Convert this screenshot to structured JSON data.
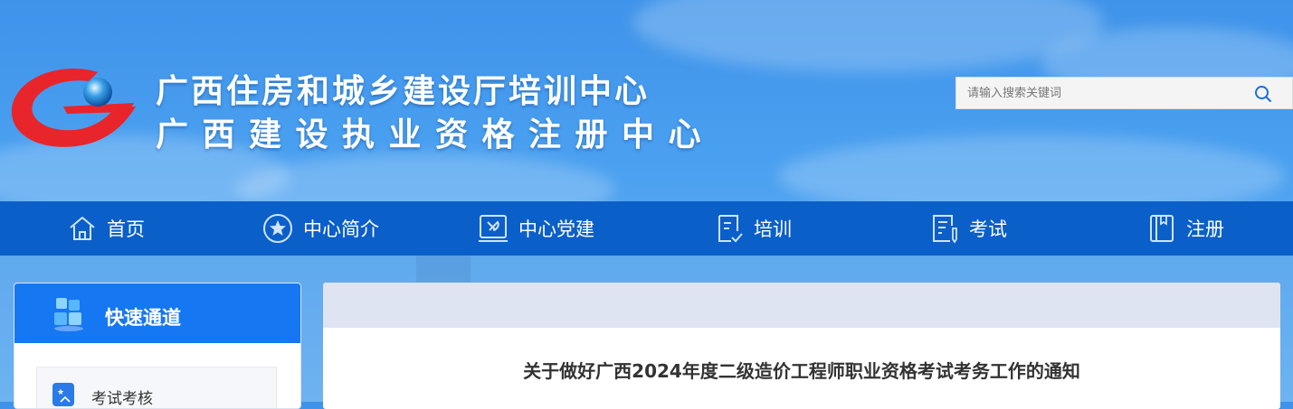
{
  "header": {
    "title_line1": "广西住房和城乡建设厅培训中心",
    "title_line2": "广西建设执业资格注册中心",
    "logo_icon": "org-logo",
    "search": {
      "placeholder": "请输入搜索关键词",
      "value": "",
      "icon": "search-icon"
    }
  },
  "nav": {
    "items": [
      {
        "label": "首页",
        "icon": "home-icon"
      },
      {
        "label": "中心简介",
        "icon": "star-circle-icon"
      },
      {
        "label": "中心党建",
        "icon": "party-emblem-icon"
      },
      {
        "label": "培训",
        "icon": "document-check-icon"
      },
      {
        "label": "考试",
        "icon": "exam-paper-icon"
      },
      {
        "label": "注册",
        "icon": "register-book-icon"
      }
    ]
  },
  "quick_access": {
    "title": "快速通道",
    "icon": "cubes-icon",
    "items": [
      {
        "label": "考试考核",
        "icon": "exam-badge-icon"
      }
    ]
  },
  "article": {
    "title": "关于做好广西2024年度二级造价工程师职业资格考试考务工作的通知"
  },
  "colors": {
    "nav_bg": "#0b5fc9",
    "quick_header_bg": "#1677f2",
    "logo_red": "#e8252b",
    "content_bar": "#dfe4f3"
  }
}
